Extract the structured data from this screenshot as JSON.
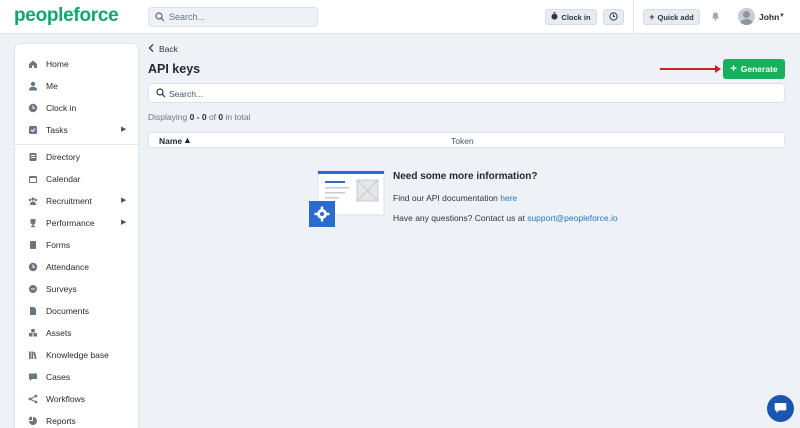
{
  "app": {
    "logo": "peopleforce"
  },
  "topbar": {
    "search_placeholder": "Search...",
    "clock_in_label": "Clock in",
    "quick_add_label": "Quick add",
    "user_name": "John"
  },
  "sidebar": {
    "items": [
      {
        "label": "Home",
        "icon": "home-icon",
        "has_submenu": false
      },
      {
        "label": "Me",
        "icon": "person-icon",
        "has_submenu": false
      },
      {
        "label": "Clock in",
        "icon": "clock-icon",
        "has_submenu": false
      },
      {
        "label": "Tasks",
        "icon": "checkbox-icon",
        "has_submenu": true
      },
      {
        "label": "Directory",
        "icon": "directory-icon",
        "has_submenu": false
      },
      {
        "label": "Calendar",
        "icon": "calendar-icon",
        "has_submenu": false
      },
      {
        "label": "Recruitment",
        "icon": "team-icon",
        "has_submenu": true
      },
      {
        "label": "Performance",
        "icon": "trophy-icon",
        "has_submenu": true
      },
      {
        "label": "Forms",
        "icon": "forms-icon",
        "has_submenu": false
      },
      {
        "label": "Attendance",
        "icon": "attendance-icon",
        "has_submenu": false
      },
      {
        "label": "Surveys",
        "icon": "survey-icon",
        "has_submenu": false
      },
      {
        "label": "Documents",
        "icon": "document-icon",
        "has_submenu": false
      },
      {
        "label": "Assets",
        "icon": "assets-icon",
        "has_submenu": false
      },
      {
        "label": "Knowledge base",
        "icon": "library-icon",
        "has_submenu": false
      },
      {
        "label": "Cases",
        "icon": "chat-icon",
        "has_submenu": false
      },
      {
        "label": "Workflows",
        "icon": "workflow-icon",
        "has_submenu": false
      },
      {
        "label": "Reports",
        "icon": "report-icon",
        "has_submenu": false
      }
    ]
  },
  "main": {
    "back_label": "Back",
    "title": "API keys",
    "generate_label": "Generate",
    "search_placeholder": "Search...",
    "count": {
      "prefix": "Displaying ",
      "range": "0 - 0",
      "of": " of ",
      "total": "0",
      "suffix": " in total"
    },
    "table": {
      "columns": [
        "Name",
        "Token"
      ]
    }
  },
  "empty_state": {
    "title": "Need some more information?",
    "line1_text": "Find our API documentation ",
    "line1_link": "here",
    "line2_text": "Have any questions? Contact us at ",
    "line2_link": "support@peopleforce.io"
  },
  "colors": {
    "brand": "#0fa86b",
    "generate_button": "#15b15d",
    "link": "#1f78c8",
    "annotation_arrow": "#d12020",
    "chat_bubble": "#1a56b0"
  }
}
